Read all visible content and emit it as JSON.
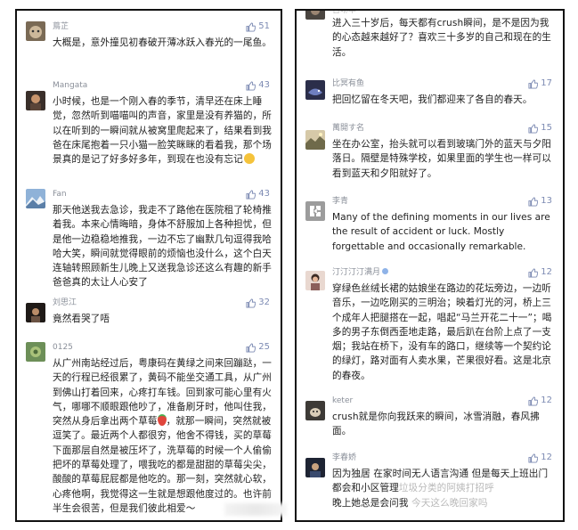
{
  "left_panel": {
    "comments": [
      {
        "user": "蔦芷",
        "likes": "51",
        "avatar": "avatar-cat",
        "text": "大概是，意外撞见初春破开薄冰跃入春光的一尾鱼。"
      },
      {
        "user": "Mangata",
        "likes": "43",
        "avatar": "avatar-figure",
        "text": "小时候，也是一个刚入春的季节，清早还在床上睡觉，忽然听到喵喵叫的声音，家里是没有养猫的，所以在听到的一瞬间就从被窝里爬起来了，结果看到我爸在床尾抱着一只小猫一脸笑眯眯的看着我，那个场景真的是记了好多好多年，到现在也没有忘记"
      },
      {
        "user": "Fan",
        "likes": "43",
        "avatar": "avatar-mountain",
        "text": "那天他送我去急诊，我走不了路他在医院租了轮椅推着我。本来心情晦暗，身体不舒服加上各种担忧，但是他一边稳稳地推我，一边不忘了幽默几句逗得我哈哈大笑，瞬间就觉得眼前的烦恼也没什么，这个白天连轴转照顾新生儿晚上又送我急诊还这么有趣的新手爸爸真的太让人心安了"
      },
      {
        "user": "刘思江",
        "likes": "32",
        "avatar": "avatar-dark",
        "text": "竟然看哭了唔"
      },
      {
        "user": "0125",
        "likes": "25",
        "avatar": "avatar-green",
        "text_a": "从广州南站经过后，粤康码在黄绿之间来回蹦跶，一天的行程已经很累了，黄码不能坐交通工具，从广州到佛山打着回来，心疼打车钱。回到家可能心里有火气，哪哪不顺眼跟他吵了，准备刷牙时，他叫住我，突然从身后拿出两个草莓",
        "text_b": "，就那一瞬间，突然就被逗笑了。最近两个人都很穷，他舍不得钱，买的草莓下面那层自然是被压坏了，洗草莓的时候一个人偷偷把坏的草莓处理了，喂我吃的都是甜甜的草莓尖尖，酸酸的草莓屁屁都是他吃的。那一刻，突然就心软，心疼他啊，我觉得这一生就是想跟他度过的。也许前半生会很苦，但是我们彼此相爱～"
      }
    ]
  },
  "right_panel": {
    "comments": [
      {
        "user": "吉琳本",
        "likes": "",
        "avatar": "avatar-top",
        "text": "进入三十岁后，每天都有crush瞬间，是不是因为我的心态越来越好了？喜欢三十多岁的自己和现在的生活。"
      },
      {
        "user": "比冥有鱼",
        "likes": "17",
        "avatar": "avatar-fish",
        "text": "把回忆留在冬天吧，我们都迎来了各自的春天。"
      },
      {
        "user": "萬開す名",
        "likes": "15",
        "avatar": "avatar-landscape",
        "text": "坐在办公室，抬头就可以看到玻璃门外的蓝天与夕阳落日。隔壁是特殊学校，如果里面的学生也一样可以看到蓝天和夕阳就好了。"
      },
      {
        "user": "李青",
        "likes": "13",
        "avatar": "avatar-puzzle",
        "text": "Many of the defining moments in our lives are the result of accident or luck. Mostly forgettable and occasionally remarkable."
      },
      {
        "user": "汀汀汀汀满月",
        "likes": "12",
        "avatar": "avatar-girl",
        "text": "穿绿色丝绒长裙的姑娘坐在路边的花坛旁边，一边听音乐，一边吃刚买的三明治；映着灯光的河，桥上三个成年人把腿搭在一起，唱起“马兰开花二十一”；喝多的男子东倒西歪地走路，最后趴在台阶上点了一支烟；我站在桥下，没有车的路口，继续等一个契约论的绿灯，路对面有人卖水果，芒果很好看。这是北京的春夜。"
      },
      {
        "user": "keter",
        "likes": "12",
        "avatar": "avatar-dog",
        "text": "crush就是你向我跃来的瞬间，冰雪消融，春风拂面。"
      },
      {
        "user": "李春娇",
        "likes": "12",
        "avatar": "avatar-night",
        "text_a": "因为独居 在家时间无人语言沟通 但是每天上班出门都会和小区管理",
        "text_b": "垃圾分类的阿姨打招呼",
        "text_c": "晚上她总是会问我",
        "text_d": "今天这么晚回家吗"
      }
    ]
  },
  "icons": {
    "like": "thumbs-up-icon",
    "emoji_laugh": "laughing-emoji-icon",
    "emoji_strawberry": "strawberry-emoji-icon"
  },
  "colors": {
    "like_blue": "#7d8bb3",
    "username_gray": "#8a8f99",
    "border": "#111111"
  }
}
